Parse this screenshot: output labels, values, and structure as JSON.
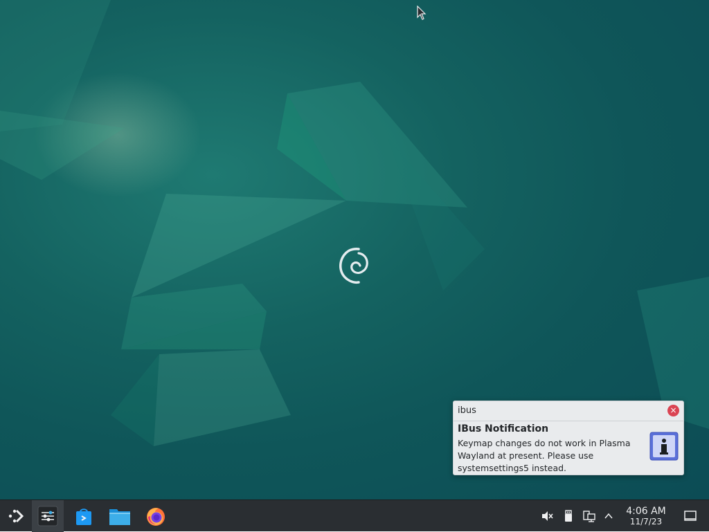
{
  "notification": {
    "app_name": "ibus",
    "close_glyph": "×",
    "title": "IBus Notification",
    "body": "Keymap changes do not work in Plasma Wayland at present. Please use systemsettings5 instead.",
    "icon": "info-icon"
  },
  "taskbar": {
    "launcher_icon": "application-launcher-icon",
    "pinned": [
      {
        "name": "system-settings",
        "icon": "sliders-icon"
      },
      {
        "name": "discover",
        "icon": "store-bag-icon"
      },
      {
        "name": "file-manager",
        "icon": "folder-icon"
      },
      {
        "name": "firefox",
        "icon": "firefox-icon"
      }
    ],
    "tray": [
      {
        "name": "volume",
        "icon": "volume-muted-icon"
      },
      {
        "name": "removable-devices",
        "icon": "usb-drive-icon"
      },
      {
        "name": "network",
        "icon": "network-wired-icon"
      },
      {
        "name": "expand-tray",
        "icon": "chevron-up-icon"
      }
    ],
    "clock": {
      "time": "4:06 AM",
      "date": "11/7/23"
    },
    "show_desktop_icon": "show-desktop-icon"
  },
  "colors": {
    "panel": "#2a2e32",
    "desktop_bg": "#0f5659",
    "accent_close": "#da4453",
    "notification_bg": "#e9ebed"
  }
}
